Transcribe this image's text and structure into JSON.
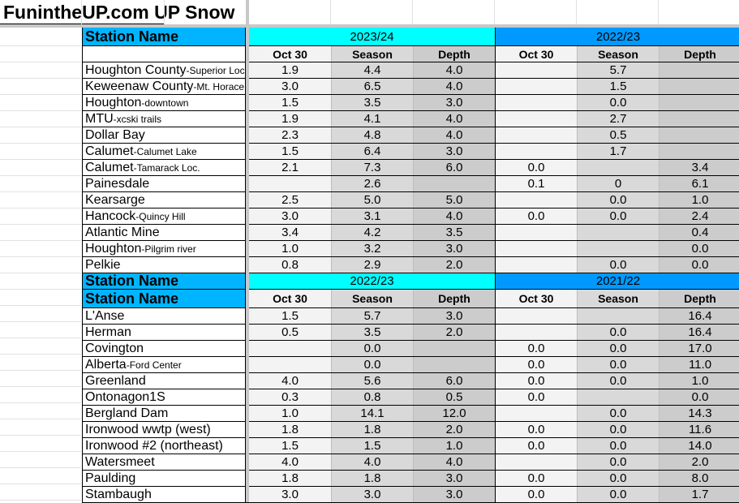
{
  "title": "FunintheUP.com UP Snow",
  "colors": {
    "station_header": "#00b4ff",
    "year_current": "#00ffff",
    "year_prior": "#0099ff"
  },
  "sections": [
    {
      "station_header": "Station Name",
      "years": [
        "2023/24",
        "2022/23"
      ],
      "columns": [
        "Oct 30",
        "Season",
        "Depth",
        "Oct 30",
        "Season",
        "Depth"
      ],
      "rows": [
        {
          "name": "Houghton County",
          "sub": "-Superior Loc",
          "values": [
            "1.9",
            "4.4",
            "4.0",
            "",
            "5.7",
            ""
          ]
        },
        {
          "name": "Keweenaw County",
          "sub": "-Mt. Horace",
          "values": [
            "3.0",
            "6.5",
            "4.0",
            "",
            "1.5",
            ""
          ]
        },
        {
          "name": "Houghton",
          "sub": "-downtown",
          "values": [
            "1.5",
            "3.5",
            "3.0",
            "",
            "0.0",
            ""
          ]
        },
        {
          "name": "MTU",
          "sub": "-xcski trails",
          "values": [
            "1.9",
            "4.1",
            "4.0",
            "",
            "2.7",
            ""
          ]
        },
        {
          "name": "Dollar Bay",
          "sub": "",
          "values": [
            "2.3",
            "4.8",
            "4.0",
            "",
            "0.5",
            ""
          ]
        },
        {
          "name": "Calumet",
          "sub": "-Calumet Lake",
          "values": [
            "1.5",
            "6.4",
            "3.0",
            "",
            "1.7",
            ""
          ]
        },
        {
          "name": "Calumet",
          "sub": "-Tamarack Loc.",
          "values": [
            "2.1",
            "7.3",
            "6.0",
            "0.0",
            "",
            "3.4"
          ]
        },
        {
          "name": "Painesdale",
          "sub": "",
          "values": [
            "",
            "2.6",
            "",
            "0.1",
            "0",
            "6.1"
          ]
        },
        {
          "name": "Kearsarge",
          "sub": "",
          "values": [
            "2.5",
            "5.0",
            "5.0",
            "",
            "0.0",
            "1.0"
          ]
        },
        {
          "name": "Hancock",
          "sub": "-Quincy Hill",
          "values": [
            "3.0",
            "3.1",
            "4.0",
            "0.0",
            "0.0",
            "2.4"
          ]
        },
        {
          "name": "Atlantic Mine",
          "sub": "",
          "values": [
            "3.4",
            "4.2",
            "3.5",
            "",
            "",
            "0.4"
          ]
        },
        {
          "name": "Houghton",
          "sub": "-Pilgrim river",
          "values": [
            "1.0",
            "3.2",
            "3.0",
            "",
            "",
            "0.0"
          ]
        },
        {
          "name": "Pelkie",
          "sub": "",
          "values": [
            "0.8",
            "2.9",
            "2.0",
            "",
            "0.0",
            "0.0"
          ]
        }
      ]
    },
    {
      "station_header": "Station Name",
      "years": [
        "2022/23",
        "2021/22"
      ],
      "columns": [
        "Oct 30",
        "Season",
        "Depth",
        "Oct 30",
        "Season",
        "Depth"
      ],
      "rows": [
        {
          "name": "L'Anse",
          "sub": "",
          "values": [
            "1.5",
            "5.7",
            "3.0",
            "",
            "",
            "16.4"
          ]
        },
        {
          "name": "Herman",
          "sub": "",
          "values": [
            "0.5",
            "3.5",
            "2.0",
            "",
            "0.0",
            "16.4"
          ]
        },
        {
          "name": "Covington",
          "sub": "",
          "values": [
            "",
            "0.0",
            "",
            "0.0",
            "0.0",
            "17.0"
          ]
        },
        {
          "name": "Alberta",
          "sub": "-Ford Center",
          "values": [
            "",
            "0.0",
            "",
            "0.0",
            "0.0",
            "11.0"
          ]
        },
        {
          "name": "Greenland",
          "sub": "",
          "values": [
            "4.0",
            "5.6",
            "6.0",
            "0.0",
            "0.0",
            "1.0"
          ]
        },
        {
          "name": "Ontonagon1S",
          "sub": "",
          "values": [
            "0.3",
            "0.8",
            "0.5",
            "0.0",
            "",
            "0.0"
          ]
        },
        {
          "name": "Bergland Dam",
          "sub": "",
          "values": [
            "1.0",
            "14.1",
            "12.0",
            "",
            "0.0",
            "14.3"
          ]
        },
        {
          "name": "Ironwood wwtp (west)",
          "sub": "",
          "values": [
            "1.8",
            "1.8",
            "2.0",
            "0.0",
            "0.0",
            "11.6"
          ]
        },
        {
          "name": "Ironwood #2 (northeast)",
          "sub": "",
          "values": [
            "1.5",
            "1.5",
            "1.0",
            "0.0",
            "0.0",
            "14.0"
          ]
        },
        {
          "name": "Watersmeet",
          "sub": "",
          "values": [
            "4.0",
            "4.0",
            "4.0",
            "",
            "0.0",
            "2.0"
          ]
        },
        {
          "name": "Paulding",
          "sub": "",
          "values": [
            "1.8",
            "1.8",
            "3.0",
            "0.0",
            "0.0",
            "8.0"
          ]
        },
        {
          "name": "Stambaugh",
          "sub": "",
          "values": [
            "3.0",
            "3.0",
            "3.0",
            "0.0",
            "0.0",
            "1.7"
          ]
        }
      ]
    }
  ]
}
